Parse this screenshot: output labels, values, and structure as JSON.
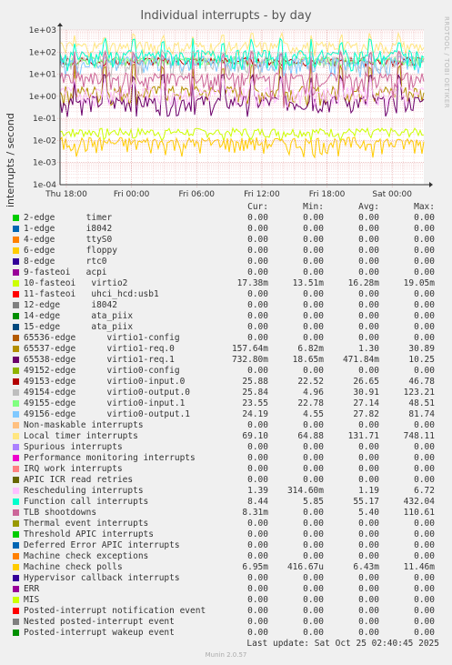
{
  "title": "Individual interrupts - by day",
  "ylabel": "interrupts / second",
  "watermark": "RRDTOOL / TOBI OETIKER",
  "legend_headers": {
    "cur": "Cur:",
    "min": "Min:",
    "avg": "Avg:",
    "max": "Max:"
  },
  "last_update": "Last update: Sat Oct 25 02:40:45 2025",
  "munin_version": "Munin 2.0.57",
  "chart_data": {
    "type": "line",
    "y_scale": "log",
    "ylim": [
      0.0001,
      1000
    ],
    "y_ticks": [
      "1e+03",
      "1e+02",
      "1e+01",
      "1e+00",
      "1e-01",
      "1e-02",
      "1e-03",
      "1e-04"
    ],
    "x_ticks": [
      "Thu 18:00",
      "Fri 00:00",
      "Fri 06:00",
      "Fri 12:00",
      "Fri 18:00",
      "Sat 00:00"
    ],
    "grid": true,
    "series": [
      {
        "name": "2-edge      timer",
        "color": "#00cc00",
        "cur": "0.00",
        "min": "0.00",
        "avg": "0.00",
        "max": "0.00"
      },
      {
        "name": "1-edge      i8042",
        "color": "#0066b3",
        "cur": "0.00",
        "min": "0.00",
        "avg": "0.00",
        "max": "0.00"
      },
      {
        "name": "4-edge      ttyS0",
        "color": "#ff8000",
        "cur": "0.00",
        "min": "0.00",
        "avg": "0.00",
        "max": "0.00"
      },
      {
        "name": "6-edge      floppy",
        "color": "#ffcc00",
        "cur": "0.00",
        "min": "0.00",
        "avg": "0.00",
        "max": "0.00"
      },
      {
        "name": "8-edge      rtc0",
        "color": "#330099",
        "cur": "0.00",
        "min": "0.00",
        "avg": "0.00",
        "max": "0.00"
      },
      {
        "name": "9-fasteoi   acpi",
        "color": "#990099",
        "cur": "0.00",
        "min": "0.00",
        "avg": "0.00",
        "max": "0.00"
      },
      {
        "name": "10-fasteoi   virtio2",
        "color": "#ccff00",
        "cur": "17.38m",
        "min": "13.51m",
        "avg": "16.28m",
        "max": "19.05m"
      },
      {
        "name": "11-fasteoi   uhci_hcd:usb1",
        "color": "#ff0000",
        "cur": "0.00",
        "min": "0.00",
        "avg": "0.00",
        "max": "0.00"
      },
      {
        "name": "12-edge      i8042",
        "color": "#808080",
        "cur": "0.00",
        "min": "0.00",
        "avg": "0.00",
        "max": "0.00"
      },
      {
        "name": "14-edge      ata_piix",
        "color": "#008f00",
        "cur": "0.00",
        "min": "0.00",
        "avg": "0.00",
        "max": "0.00"
      },
      {
        "name": "15-edge      ata_piix",
        "color": "#00487d",
        "cur": "0.00",
        "min": "0.00",
        "avg": "0.00",
        "max": "0.00"
      },
      {
        "name": "65536-edge      virtio1-config",
        "color": "#b35a00",
        "cur": "0.00",
        "min": "0.00",
        "avg": "0.00",
        "max": "0.00"
      },
      {
        "name": "65537-edge      virtio1-req.0",
        "color": "#b38f00",
        "cur": "157.64m",
        "min": "6.82m",
        "avg": "1.30",
        "max": "30.89"
      },
      {
        "name": "65538-edge      virtio1-req.1",
        "color": "#6b006b",
        "cur": "732.80m",
        "min": "18.65m",
        "avg": "471.84m",
        "max": "10.25"
      },
      {
        "name": "49152-edge      virtio0-config",
        "color": "#8fb300",
        "cur": "0.00",
        "min": "0.00",
        "avg": "0.00",
        "max": "0.00"
      },
      {
        "name": "49153-edge      virtio0-input.0",
        "color": "#b30000",
        "cur": "25.88",
        "min": "22.52",
        "avg": "26.65",
        "max": "46.78"
      },
      {
        "name": "49154-edge      virtio0-output.0",
        "color": "#bebebe",
        "cur": "25.84",
        "min": "4.96",
        "avg": "30.91",
        "max": "123.21"
      },
      {
        "name": "49155-edge      virtio0-input.1",
        "color": "#80ff80",
        "cur": "23.55",
        "min": "22.78",
        "avg": "27.14",
        "max": "48.51"
      },
      {
        "name": "49156-edge      virtio0-output.1",
        "color": "#80c9ff",
        "cur": "24.19",
        "min": "4.55",
        "avg": "27.82",
        "max": "81.74"
      },
      {
        "name": "Non-maskable interrupts",
        "color": "#ffc080",
        "cur": "0.00",
        "min": "0.00",
        "avg": "0.00",
        "max": "0.00"
      },
      {
        "name": "Local timer interrupts",
        "color": "#ffe680",
        "cur": "69.10",
        "min": "64.88",
        "avg": "131.71",
        "max": "748.11"
      },
      {
        "name": "Spurious interrupts",
        "color": "#aa80ff",
        "cur": "0.00",
        "min": "0.00",
        "avg": "0.00",
        "max": "0.00"
      },
      {
        "name": "Performance monitoring interrupts",
        "color": "#ee00cc",
        "cur": "0.00",
        "min": "0.00",
        "avg": "0.00",
        "max": "0.00"
      },
      {
        "name": "IRQ work interrupts",
        "color": "#ff8080",
        "cur": "0.00",
        "min": "0.00",
        "avg": "0.00",
        "max": "0.00"
      },
      {
        "name": "APIC ICR read retries",
        "color": "#666600",
        "cur": "0.00",
        "min": "0.00",
        "avg": "0.00",
        "max": "0.00"
      },
      {
        "name": "Rescheduling interrupts",
        "color": "#ffbfff",
        "cur": "1.39",
        "min": "314.60m",
        "avg": "1.19",
        "max": "6.72"
      },
      {
        "name": "Function call interrupts",
        "color": "#00ffcc",
        "cur": "8.44",
        "min": "5.85",
        "avg": "55.17",
        "max": "432.04"
      },
      {
        "name": "TLB shootdowns",
        "color": "#cc6699",
        "cur": "8.31m",
        "min": "0.00",
        "avg": "5.40",
        "max": "110.61"
      },
      {
        "name": "Thermal event interrupts",
        "color": "#999900",
        "cur": "0.00",
        "min": "0.00",
        "avg": "0.00",
        "max": "0.00"
      },
      {
        "name": "Threshold APIC interrupts",
        "color": "#00cc00",
        "cur": "0.00",
        "min": "0.00",
        "avg": "0.00",
        "max": "0.00"
      },
      {
        "name": "Deferred Error APIC interrupts",
        "color": "#0066b3",
        "cur": "0.00",
        "min": "0.00",
        "avg": "0.00",
        "max": "0.00"
      },
      {
        "name": "Machine check exceptions",
        "color": "#ff8000",
        "cur": "0.00",
        "min": "0.00",
        "avg": "0.00",
        "max": "0.00"
      },
      {
        "name": "Machine check polls",
        "color": "#ffcc00",
        "cur": "6.95m",
        "min": "416.67u",
        "avg": "6.43m",
        "max": "11.46m"
      },
      {
        "name": "Hypervisor callback interrupts",
        "color": "#330099",
        "cur": "0.00",
        "min": "0.00",
        "avg": "0.00",
        "max": "0.00"
      },
      {
        "name": "ERR",
        "color": "#990099",
        "cur": "0.00",
        "min": "0.00",
        "avg": "0.00",
        "max": "0.00"
      },
      {
        "name": "MIS",
        "color": "#ccff00",
        "cur": "0.00",
        "min": "0.00",
        "avg": "0.00",
        "max": "0.00"
      },
      {
        "name": "Posted-interrupt notification event",
        "color": "#ff0000",
        "cur": "0.00",
        "min": "0.00",
        "avg": "0.00",
        "max": "0.00"
      },
      {
        "name": "Nested posted-interrupt event",
        "color": "#808080",
        "cur": "0.00",
        "min": "0.00",
        "avg": "0.00",
        "max": "0.00"
      },
      {
        "name": "Posted-interrupt wakeup event",
        "color": "#008f00",
        "cur": "0.00",
        "min": "0.00",
        "avg": "0.00",
        "max": "0.00"
      }
    ]
  }
}
